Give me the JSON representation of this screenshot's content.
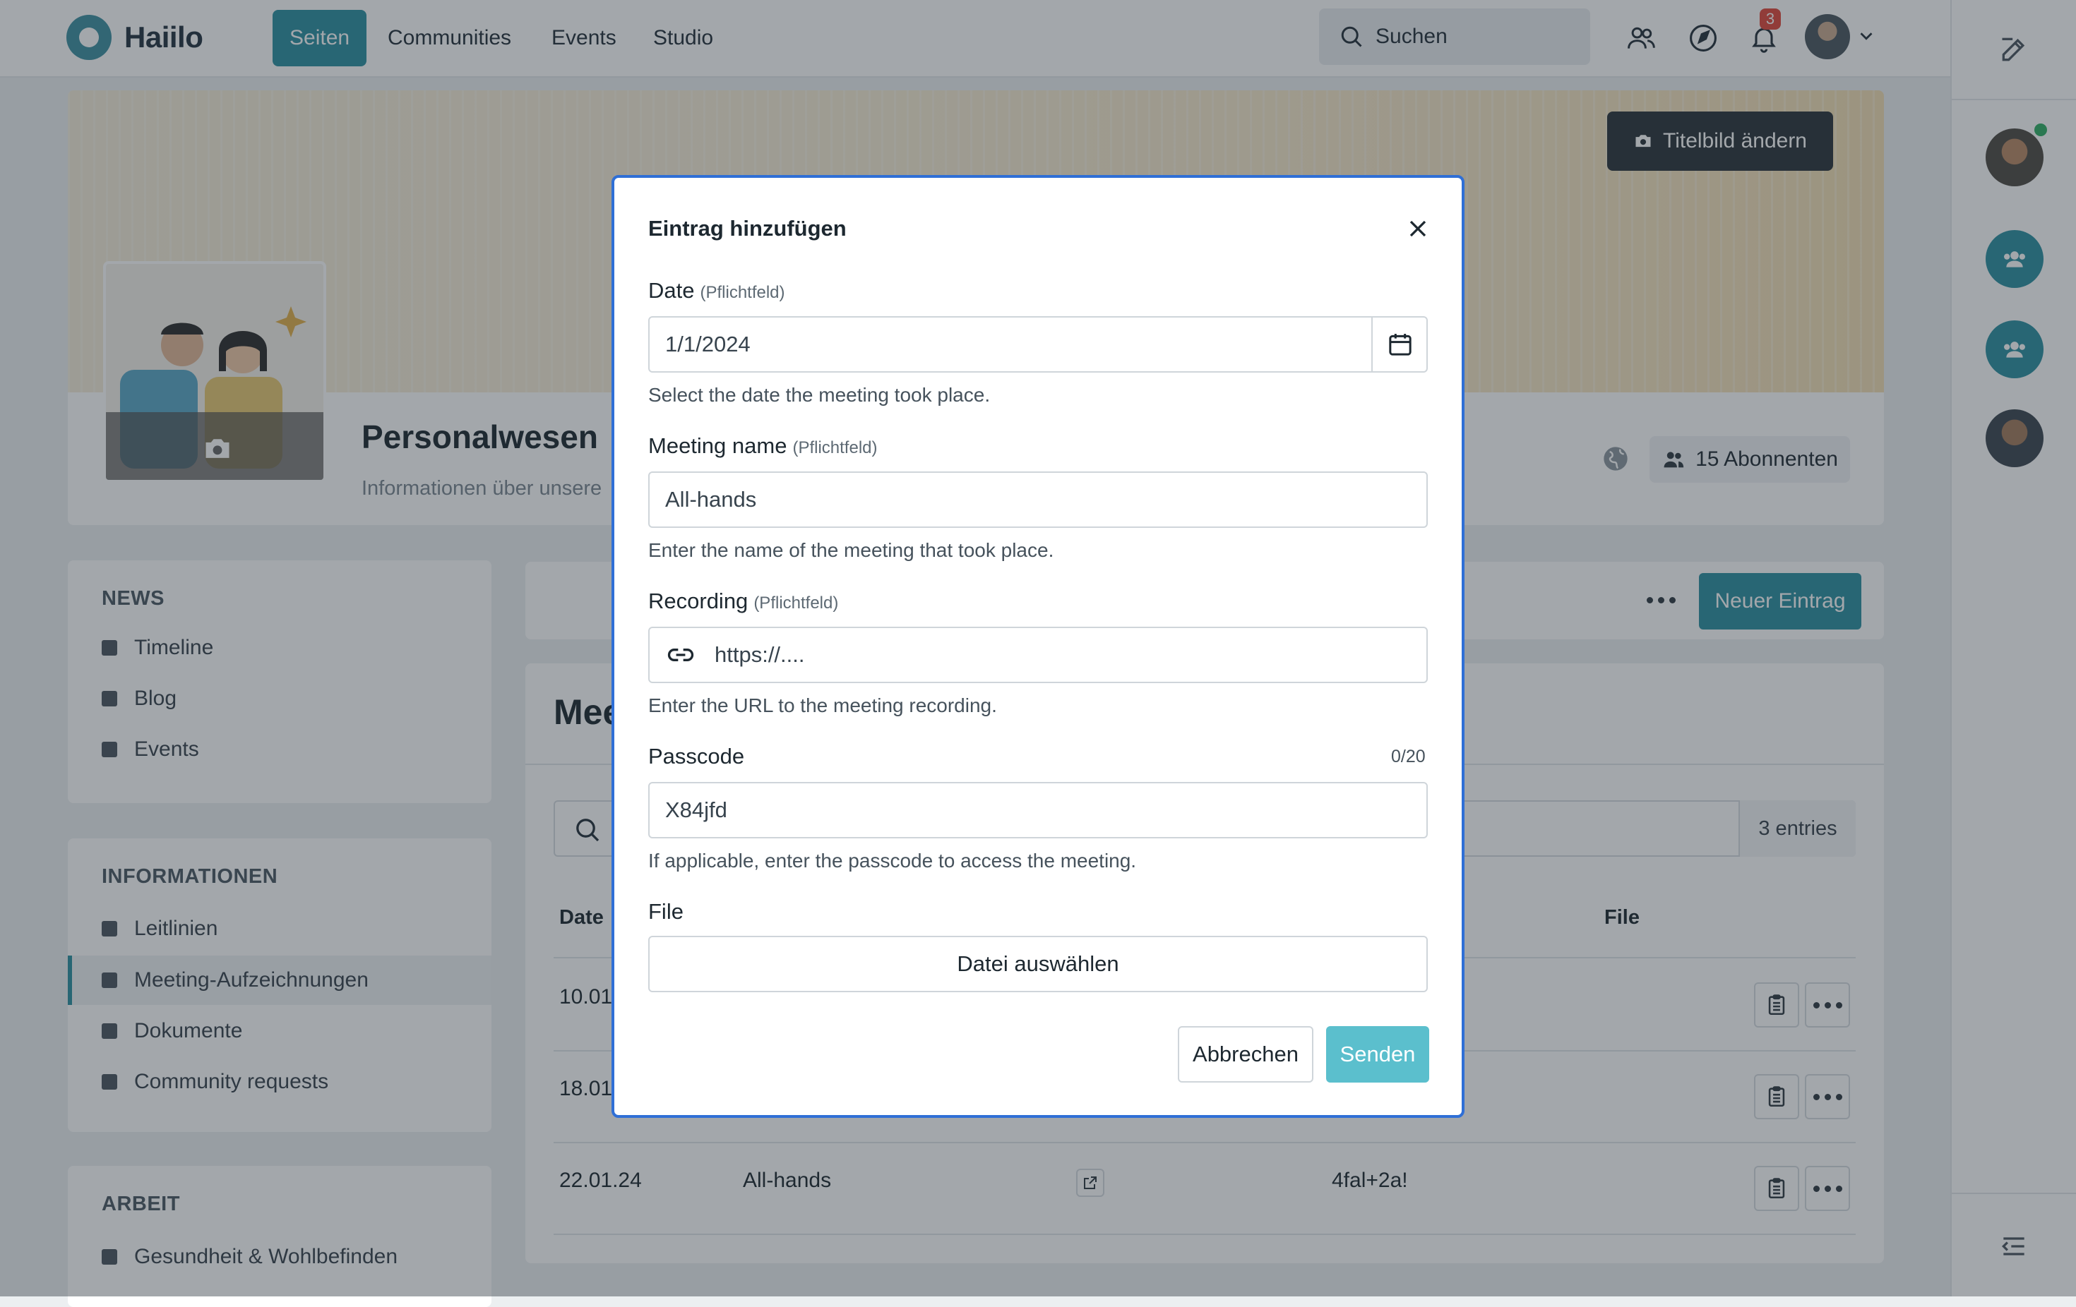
{
  "app": {
    "logo_text": "Haiilo"
  },
  "topnav": {
    "items": [
      {
        "label": "Seiten",
        "active": true
      },
      {
        "label": "Communities"
      },
      {
        "label": "Events"
      },
      {
        "label": "Studio"
      }
    ],
    "search_placeholder": "Suchen",
    "notification_count": "3"
  },
  "page": {
    "cover_button": "Titelbild ändern",
    "title": "Personalwesen",
    "subtitle": "Informationen über unsere",
    "subscribers": "15 Abonnenten"
  },
  "sidebar": {
    "sections": [
      {
        "title": "NEWS",
        "items": [
          "Timeline",
          "Blog",
          "Events"
        ]
      },
      {
        "title": "INFORMATIONEN",
        "items": [
          "Leitlinien",
          "Meeting-Aufzeichnungen",
          "Dokumente",
          "Community requests"
        ]
      },
      {
        "title": "ARBEIT",
        "items": [
          "Gesundheit & Wohlbefinden"
        ]
      }
    ]
  },
  "content": {
    "new_entry_button": "Neuer Eintrag",
    "heading_partial": "Mee",
    "entries_count": "3 entries",
    "columns": {
      "date": "Date",
      "file": "File"
    },
    "rows": [
      {
        "date": "10.01",
        "name": "",
        "passcode": ""
      },
      {
        "date": "18.01",
        "name": "",
        "passcode": ""
      },
      {
        "date": "22.01.24",
        "name": "All-hands",
        "passcode": "4fal+2a!"
      }
    ]
  },
  "modal": {
    "title": "Eintrag hinzufügen",
    "required_tag": "(Pflichtfeld)",
    "date": {
      "label": "Date",
      "value": "1/1/2024",
      "help": "Select the date the meeting took place."
    },
    "meeting_name": {
      "label": "Meeting name",
      "value": "All-hands",
      "help": "Enter the name of the meeting that took place."
    },
    "recording": {
      "label": "Recording",
      "placeholder": "https://....",
      "help": "Enter the URL to the meeting recording."
    },
    "passcode": {
      "label": "Passcode",
      "counter": "0/20",
      "value": "X84jfd",
      "help": "If applicable, enter the passcode to access the meeting."
    },
    "file": {
      "label": "File",
      "button": "Datei auswählen"
    },
    "cancel_button": "Abbrechen",
    "submit_button": "Senden"
  },
  "colors": {
    "accent": "#2b8fa0",
    "modal_border": "#2f6fd6",
    "send_button": "#5bbfcd",
    "badge": "#e0483b"
  }
}
